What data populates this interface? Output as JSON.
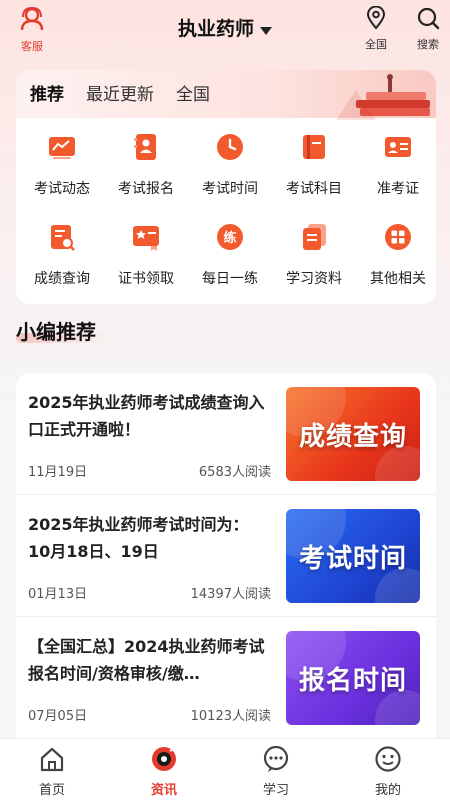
{
  "header": {
    "title": "执业药师",
    "service_label": "客服",
    "region_label": "全国",
    "search_label": "搜索"
  },
  "tabs": [
    {
      "label": "推荐",
      "active": true
    },
    {
      "label": "最近更新",
      "active": false
    },
    {
      "label": "全国",
      "active": false
    }
  ],
  "quick_links": [
    {
      "label": "考试动态",
      "icon": "chart-icon"
    },
    {
      "label": "考试报名",
      "icon": "register-icon"
    },
    {
      "label": "考试时间",
      "icon": "clock-icon"
    },
    {
      "label": "考试科目",
      "icon": "book-icon"
    },
    {
      "label": "准考证",
      "icon": "id-card-icon"
    },
    {
      "label": "成绩查询",
      "icon": "score-search-icon"
    },
    {
      "label": "证书领取",
      "icon": "certificate-icon"
    },
    {
      "label": "每日一练",
      "icon": "practice-icon"
    },
    {
      "label": "学习资料",
      "icon": "documents-icon"
    },
    {
      "label": "其他相关",
      "icon": "grid-icon"
    }
  ],
  "practice_icon_char": "练",
  "section_title": "小编推荐",
  "articles": [
    {
      "title": "2025年执业药师考试成绩查询入口正式开通啦！",
      "date": "11月19日",
      "reads": "6583人阅读",
      "thumb_text": "成绩查询",
      "thumb_color": "#e9361c"
    },
    {
      "title": "2025年执业药师考试时间为：10月18日、19日",
      "date": "01月13日",
      "reads": "14397人阅读",
      "thumb_text": "考试时间",
      "thumb_color": "#1f45d4"
    },
    {
      "title": "【全国汇总】2024执业药师考试报名时间/资格审核/缴…",
      "date": "07月05日",
      "reads": "10123人阅读",
      "thumb_text": "报名时间",
      "thumb_color": "#6b31de"
    }
  ],
  "bottom_nav": [
    {
      "label": "首页",
      "icon": "home-icon",
      "active": false
    },
    {
      "label": "资讯",
      "icon": "news-icon",
      "active": true
    },
    {
      "label": "学习",
      "icon": "chat-icon",
      "active": false
    },
    {
      "label": "我的",
      "icon": "profile-icon",
      "active": false
    }
  ],
  "colors": {
    "accent": "#e33b2e",
    "icon_orange": "#f25a2e"
  }
}
